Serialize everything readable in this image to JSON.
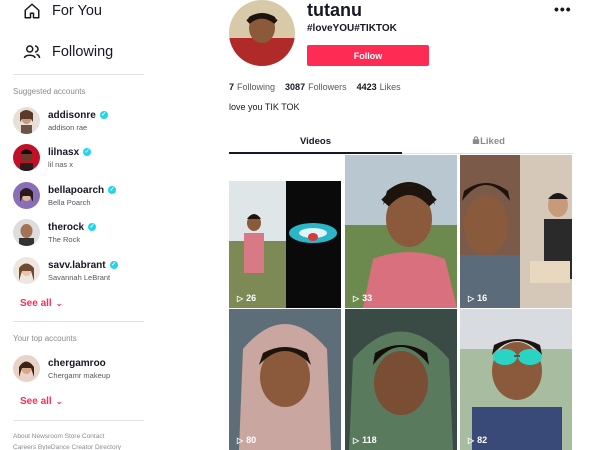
{
  "sidebar": {
    "nav": [
      {
        "label": "For You",
        "icon": "home-icon"
      },
      {
        "label": "Following",
        "icon": "users-icon"
      }
    ],
    "suggested_title": "Suggested accounts",
    "suggested": [
      {
        "username": "addisonre",
        "name": "addison rae"
      },
      {
        "username": "lilnasx",
        "name": "lil nas x"
      },
      {
        "username": "bellapoarch",
        "name": "Bella Poarch"
      },
      {
        "username": "therock",
        "name": "The Rock"
      },
      {
        "username": "savv.labrant",
        "name": "Savannah LeBrant"
      }
    ],
    "see_all": "See all",
    "top_title": "Your top accounts",
    "top": [
      {
        "username": "chergamroo",
        "name": "Chergamr makeup"
      }
    ],
    "see_all_2": "See all",
    "footer_line1": "About  Newsroom  Store  Contact",
    "footer_line2": "Careers  ByteDance  Creator Directory"
  },
  "profile": {
    "username": "tutanu",
    "nickname": "#loveYOU#TIKTOK",
    "follow_label": "Follow",
    "more_label": "•••",
    "following_count": "7",
    "following_label": "Following",
    "followers_count": "3087",
    "followers_label": "Followers",
    "likes_count": "4423",
    "likes_label": "Likes",
    "bio": "love you TIK TOK"
  },
  "tabs": {
    "videos": "Videos",
    "liked": "Liked"
  },
  "videos": [
    {
      "views": "26"
    },
    {
      "views": "33"
    },
    {
      "views": "16"
    },
    {
      "views": "80"
    },
    {
      "views": "118"
    },
    {
      "views": "82"
    }
  ],
  "colors": {
    "accent": "#fe2c55",
    "verified": "#20d5ec",
    "text": "#161823",
    "muted": "#8a8b91"
  }
}
